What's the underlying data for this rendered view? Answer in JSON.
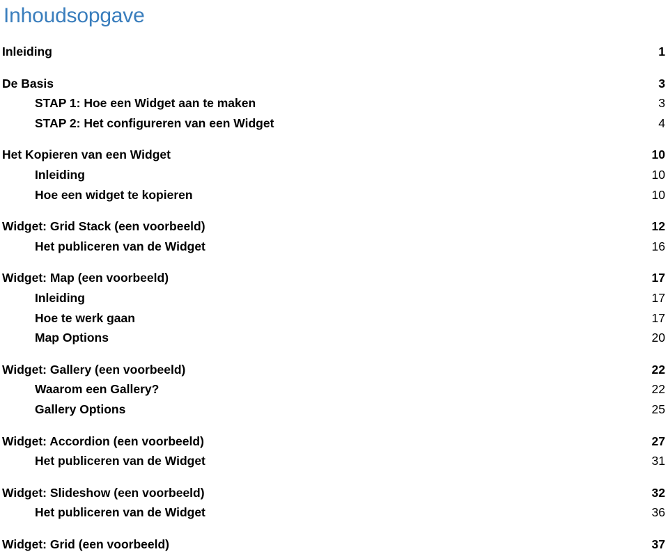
{
  "document": {
    "title": "Inhoudsopgave",
    "title_color": "#3A7EBD",
    "text_color": "#000000",
    "background_color": "#FFFFFF"
  },
  "toc": {
    "groups": [
      {
        "entries": [
          {
            "label": "Inleiding",
            "page": "1",
            "level": 1
          }
        ]
      },
      {
        "entries": [
          {
            "label": "De Basis",
            "page": "3",
            "level": 1
          },
          {
            "label": "STAP 1: Hoe een Widget aan te maken",
            "page": "3",
            "level": 2
          },
          {
            "label": "STAP 2: Het configureren van een Widget",
            "page": "4",
            "level": 2
          }
        ]
      },
      {
        "entries": [
          {
            "label": "Het Kopieren van een Widget",
            "page": "10",
            "level": 1
          },
          {
            "label": "Inleiding",
            "page": "10",
            "level": 2
          },
          {
            "label": "Hoe een widget te kopieren",
            "page": "10",
            "level": 2
          }
        ]
      },
      {
        "entries": [
          {
            "label": "Widget: Grid Stack (een voorbeeld)",
            "page": "12",
            "level": 1
          },
          {
            "label": "Het publiceren van de Widget",
            "page": "16",
            "level": 2
          }
        ]
      },
      {
        "entries": [
          {
            "label": "Widget: Map (een voorbeeld)",
            "page": "17",
            "level": 1
          },
          {
            "label": "Inleiding",
            "page": "17",
            "level": 2
          },
          {
            "label": "Hoe te werk gaan",
            "page": "17",
            "level": 2
          },
          {
            "label": "Map Options",
            "page": "20",
            "level": 2
          }
        ]
      },
      {
        "entries": [
          {
            "label": "Widget: Gallery (een voorbeeld)",
            "page": "22",
            "level": 1
          },
          {
            "label": "Waarom een Gallery?",
            "page": "22",
            "level": 2
          },
          {
            "label": "Gallery Options",
            "page": "25",
            "level": 2
          }
        ]
      },
      {
        "entries": [
          {
            "label": "Widget: Accordion (een voorbeeld)",
            "page": "27",
            "level": 1
          },
          {
            "label": "Het publiceren van de Widget",
            "page": "31",
            "level": 2
          }
        ]
      },
      {
        "entries": [
          {
            "label": "Widget: Slideshow (een voorbeeld)",
            "page": "32",
            "level": 1
          },
          {
            "label": "Het publiceren van de Widget",
            "page": "36",
            "level": 2
          }
        ]
      },
      {
        "entries": [
          {
            "label": "Widget: Grid (een voorbeeld)",
            "page": "37",
            "level": 1
          }
        ]
      }
    ]
  }
}
